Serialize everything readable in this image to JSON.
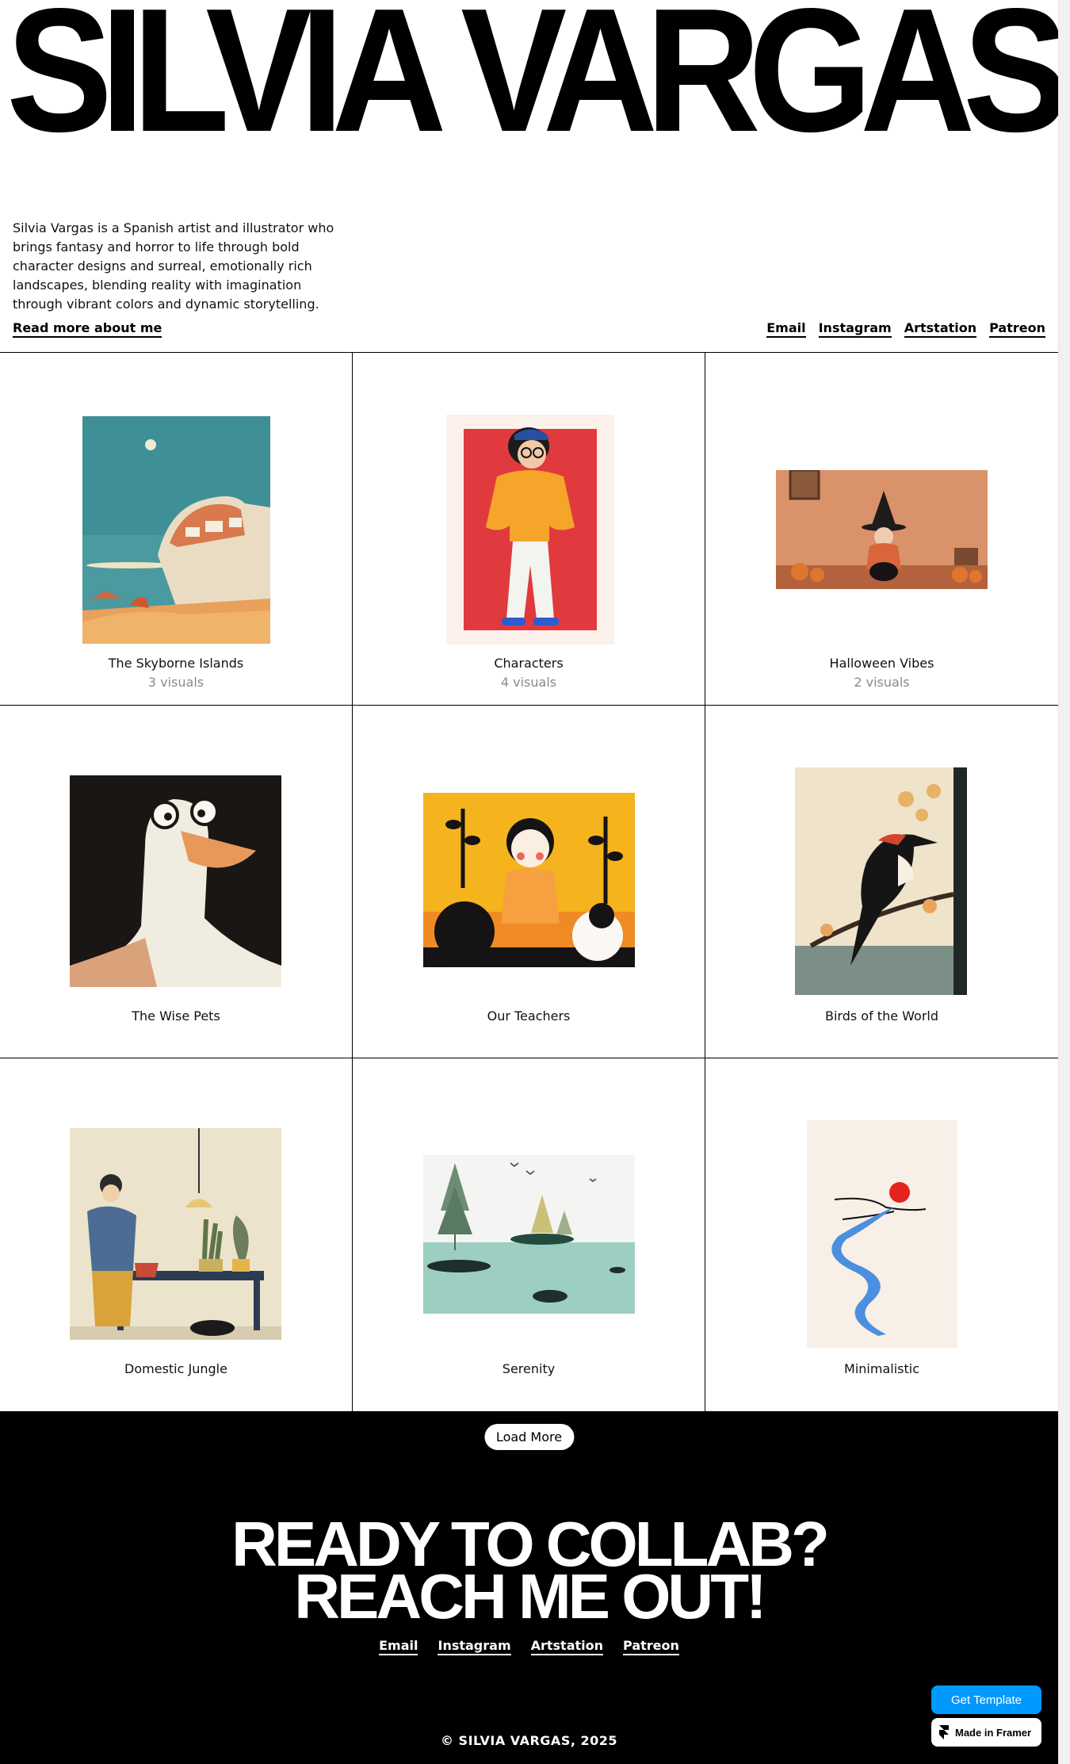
{
  "header": {
    "title": "SILVIA VARGAS",
    "bio": "Silvia Vargas is a Spanish artist and illustrator who brings fantasy and horror to life through bold character designs and surreal, emotionally rich landscapes, blending reality with imagination through vibrant colors and dynamic storytelling.",
    "read_more": "Read more about me",
    "social": [
      "Email",
      "Instagram",
      "Artstation",
      "Patreon"
    ]
  },
  "gallery": [
    {
      "title": "The Skyborne Islands",
      "count": "3 visuals",
      "icon": "island-illustration"
    },
    {
      "title": "Characters",
      "count": "4 visuals",
      "icon": "character-illustration"
    },
    {
      "title": "Halloween Vibes",
      "count": "2 visuals",
      "icon": "witch-illustration"
    },
    {
      "title": "The Wise Pets",
      "count": "",
      "icon": "goose-illustration"
    },
    {
      "title": "Our Teachers",
      "count": "",
      "icon": "teacher-illustration"
    },
    {
      "title": "Birds of the World",
      "count": "",
      "icon": "woodpecker-illustration"
    },
    {
      "title": "Domestic Jungle",
      "count": "",
      "icon": "plants-illustration"
    },
    {
      "title": "Serenity",
      "count": "",
      "icon": "lake-illustration"
    },
    {
      "title": "Minimalistic",
      "count": "",
      "icon": "river-sun-illustration"
    }
  ],
  "footer": {
    "load_more": "Load More",
    "cta_line1": "READY TO COLLAB?",
    "cta_line2": "REACH ME OUT!",
    "social": [
      "Email",
      "Instagram",
      "Artstation",
      "Patreon"
    ],
    "copyright": "© SILVIA VARGAS, 2025"
  },
  "badges": {
    "get_template": "Get Template",
    "made_in_framer": "Made in Framer"
  },
  "colors": {
    "background": "#ffffff",
    "footer_bg": "#000000",
    "accent_blue": "#0099ff",
    "muted_text": "#8a8a8a"
  }
}
